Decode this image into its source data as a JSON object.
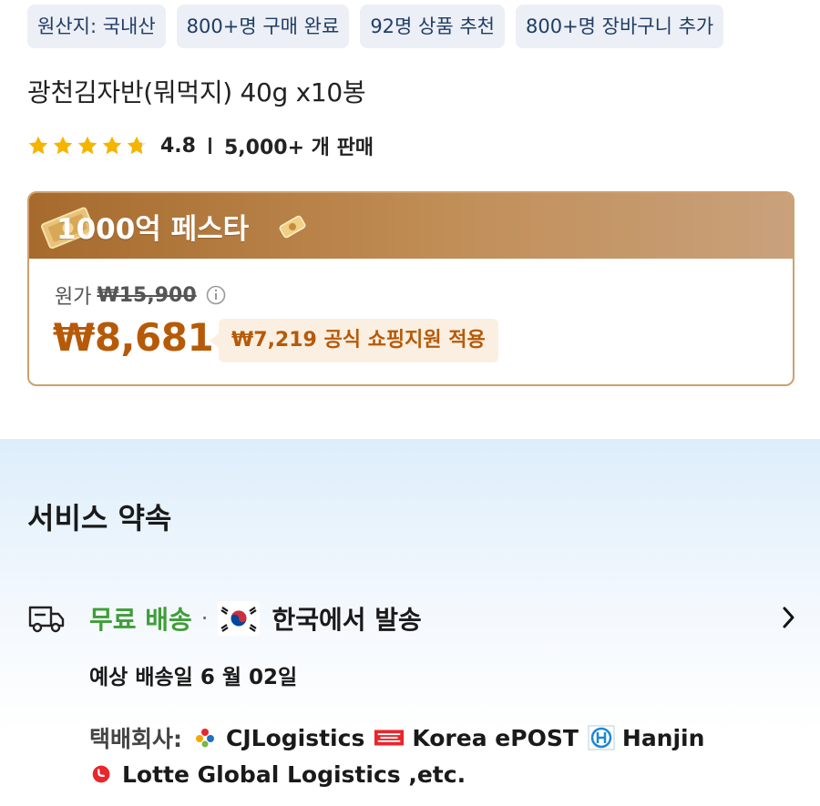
{
  "chips": [
    "원산지: 국내산",
    "800+명 구매 완료",
    "92명 상품 추천",
    "800+명 장바구니 추가"
  ],
  "product": {
    "title": "광천김자반(뭐먹지) 40g x10봉",
    "rating": "4.8",
    "stars": 4.8,
    "sold": "5,000+ 개 판매"
  },
  "promo": {
    "banner": "1000억 페스타",
    "original_label": "원가",
    "original_price": "₩15,900",
    "price": "₩8,681",
    "discount": "₩7,219 공식 쇼핑지원 적용"
  },
  "service": {
    "title": "서비스 약속",
    "free_shipping": "무료 배송",
    "dot": "·",
    "ships_from": "한국에서 발송",
    "eta": "예상 배송일 6 월 02일",
    "carrier_label": "택배회사:",
    "carriers": [
      "CJLogistics",
      "Korea ePOST",
      "Hanjin",
      "Lotte Global Logistics ,etc."
    ]
  },
  "colors": {
    "accent": "#b65a08",
    "promo_header": "#a66a2c",
    "free_green": "#3e9e38",
    "chip_bg": "#eceff5",
    "star": "#f5b400"
  }
}
